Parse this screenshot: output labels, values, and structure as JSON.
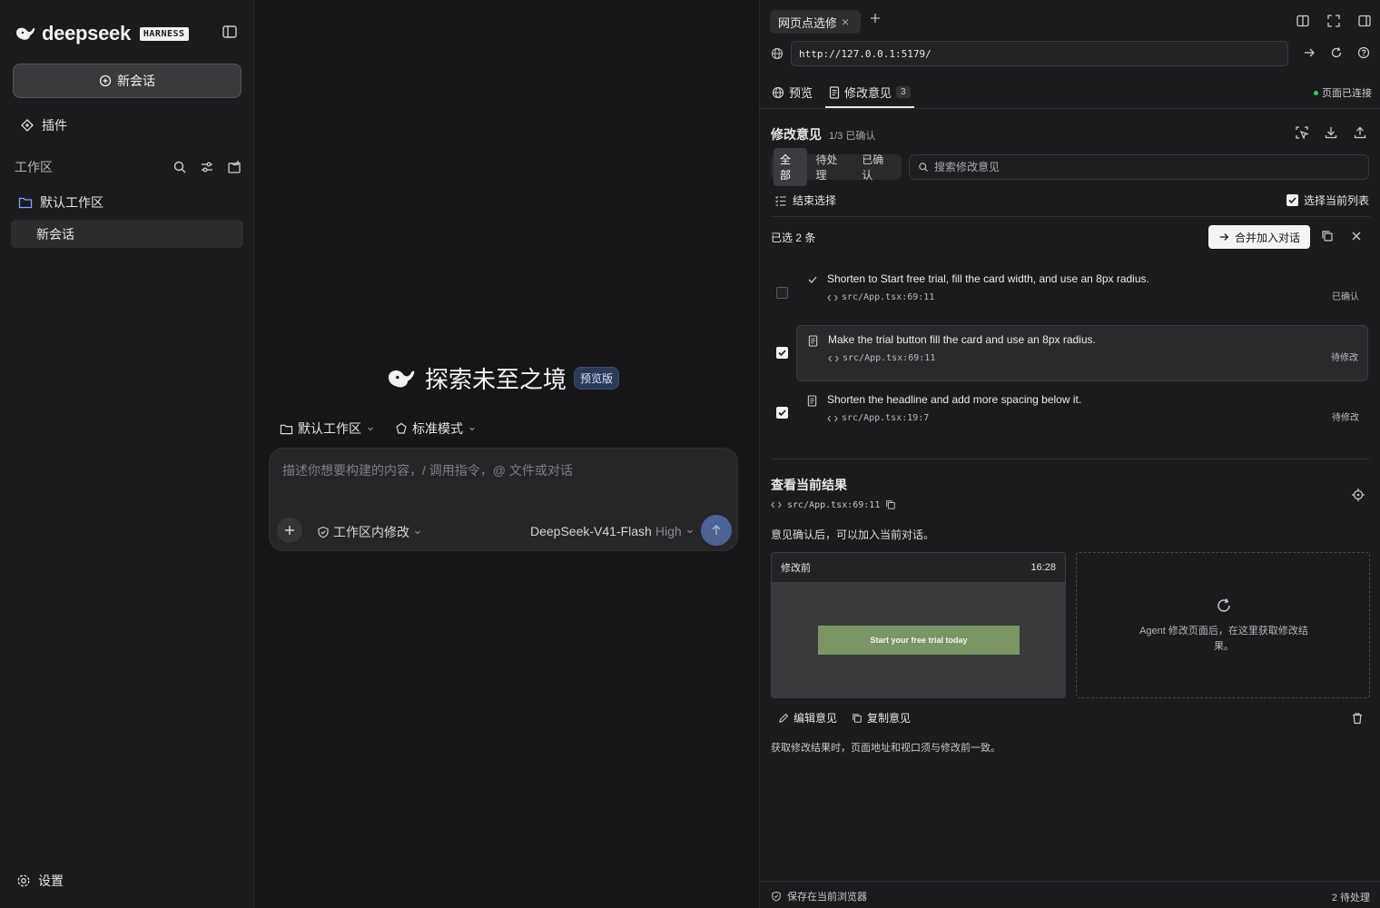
{
  "sidebar": {
    "logo_text": "deepseek",
    "logo_badge": "HARNESS",
    "new_chat_label": "新会话",
    "plugins_label": "插件",
    "workspace_label": "工作区",
    "workspace_folder": "默认工作区",
    "conversations": [
      {
        "label": "新会话"
      }
    ],
    "settings_label": "设置"
  },
  "center": {
    "hero_title": "探索未至之境",
    "hero_badge": "预览版",
    "context_workspace": "默认工作区",
    "context_mode": "标准模式",
    "composer_placeholder": "描述你想要构建的内容，/ 调用指令，@ 文件或对话",
    "scope_label": "工作区内修改",
    "model_name": "DeepSeek-V41-Flash",
    "model_effort": "High"
  },
  "browser": {
    "tab_title": "网页点选修改",
    "url": "http://127.0.0.1:5179/",
    "subtab_preview": "预览",
    "subtab_feedback": "修改意见",
    "feedback_count": "3",
    "connection_status": "页面已连接"
  },
  "feedback": {
    "title": "修改意见",
    "confirmed_summary": "1/3 已确认",
    "filters": [
      "全部",
      "待处理",
      "已确认"
    ],
    "active_filter": 0,
    "search_placeholder": "搜索修改意见",
    "end_selection_label": "结束选择",
    "select_list_label": "选择当前列表",
    "selected_count_label": "已选 2 条",
    "merge_button_label": "合并加入对话",
    "items": [
      {
        "text": "Shorten to Start free trial, fill the card width, and use an 8px radius.",
        "path": "src/App.tsx:69:11",
        "status": "已确认",
        "checked": false
      },
      {
        "text": "Make the trial button fill the card and use an 8px radius.",
        "path": "src/App.tsx:69:11",
        "status": "待修改",
        "checked": true
      },
      {
        "text": "Shorten the headline and add more spacing below it.",
        "path": "src/App.tsx:19:7",
        "status": "待修改",
        "checked": true
      }
    ]
  },
  "result": {
    "title": "查看当前结果",
    "path": "src/App.tsx:69:11",
    "note": "意见确认后，可以加入当前对话。",
    "before_label": "修改前",
    "before_time": "16:28",
    "preview_button_text": "Start your free trial today",
    "after_placeholder": "Agent 修改页面后，在这里获取修改结果。",
    "edit_label": "编辑意见",
    "copy_label": "复制意见",
    "footnote": "获取修改结果时，页面地址和视口须与修改前一致。"
  },
  "statusbar": {
    "saved_label": "保存在当前浏览器",
    "pending_label": "2 待处理"
  },
  "colors": {
    "accent_send": "#4e6393",
    "preview_button": "#7b9662",
    "connected": "#3ec46d"
  }
}
